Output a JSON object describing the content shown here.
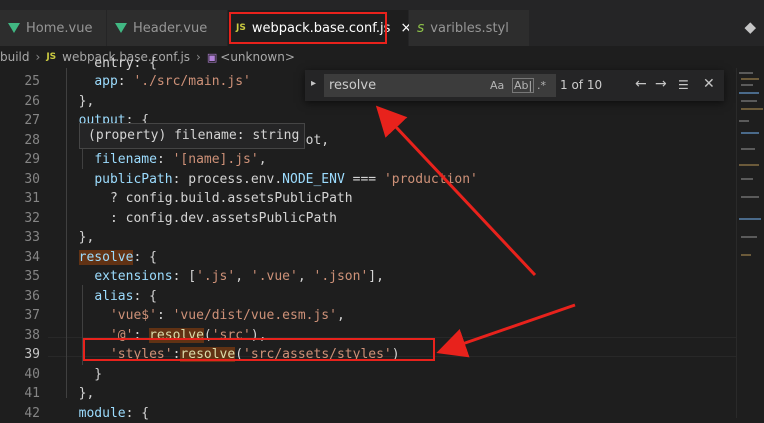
{
  "tabs": [
    {
      "label": "Home.vue",
      "icon": "vue-icon"
    },
    {
      "label": "Header.vue",
      "icon": "vue-icon"
    },
    {
      "label": "webpack.base.conf.js",
      "icon": "js-icon",
      "badge": "JS",
      "active": true,
      "close": "×"
    },
    {
      "label": "varibles.styl",
      "icon": "styl-icon"
    }
  ],
  "breadcrumb": {
    "folder": "build",
    "file_badge": "JS",
    "file": "webpack.base.conf.js",
    "symbol": "<unknown>"
  },
  "find_widget": {
    "query": "resolve",
    "match_case": "Aa",
    "whole_word": "Ab|",
    "regex": ".*",
    "count": "1 of 10"
  },
  "hover": {
    "text": "(property) filename: string"
  },
  "lines": [
    {
      "n": "25",
      "html": "    <span class=\"k\">app</span>: <span class=\"s\">'./src/main.js'</span>"
    },
    {
      "n": "26",
      "html": "  },"
    },
    {
      "n": "27",
      "html": "  <span class=\"k\">output</span>: {"
    },
    {
      "n": "28",
      "html": "    <span class=\"k\">path</span>: <span class=\"p\">config.build.assetsRoot</span>,"
    },
    {
      "n": "29",
      "html": "    <span class=\"k\">filename</span>: <span class=\"s\">'[name].js'</span>,"
    },
    {
      "n": "30",
      "html": "    <span class=\"k\">publicPath</span>: process.env.<span class=\"k\">NODE_ENV</span> === <span class=\"s\">'production'</span>"
    },
    {
      "n": "31",
      "html": "      ? config.build.assetsPublicPath"
    },
    {
      "n": "32",
      "html": "      : config.dev.assetsPublicPath"
    },
    {
      "n": "33",
      "html": "  },"
    },
    {
      "n": "34",
      "html": "  <span class=\"k h\">resolve</span>: {"
    },
    {
      "n": "35",
      "html": "    <span class=\"k\">extensions</span>: [<span class=\"s\">'.js'</span>, <span class=\"s\">'.vue'</span>, <span class=\"s\">'.json'</span>],"
    },
    {
      "n": "36",
      "html": "    <span class=\"k\">alias</span>: {"
    },
    {
      "n": "37",
      "html": "      <span class=\"s\">'vue$'</span>: <span class=\"s\">'vue/dist/vue.esm.js'</span>,"
    },
    {
      "n": "38",
      "html": "      <span class=\"s\">'@'</span>: <span class=\"f h\">resolve</span>(<span class=\"s\">'src'</span>),"
    },
    {
      "n": "39",
      "html": "      <span class=\"s\">'styles'</span>:<span class=\"f h\">resolve</span>(<span class=\"s\">'src/assets/styles'</span>)"
    },
    {
      "n": "40",
      "html": "    }"
    },
    {
      "n": "41",
      "html": "  },"
    },
    {
      "n": "42",
      "html": "  <span class=\"k\">module</span>: {"
    }
  ],
  "partial_top_line": "    entry: {",
  "current_line": "39"
}
